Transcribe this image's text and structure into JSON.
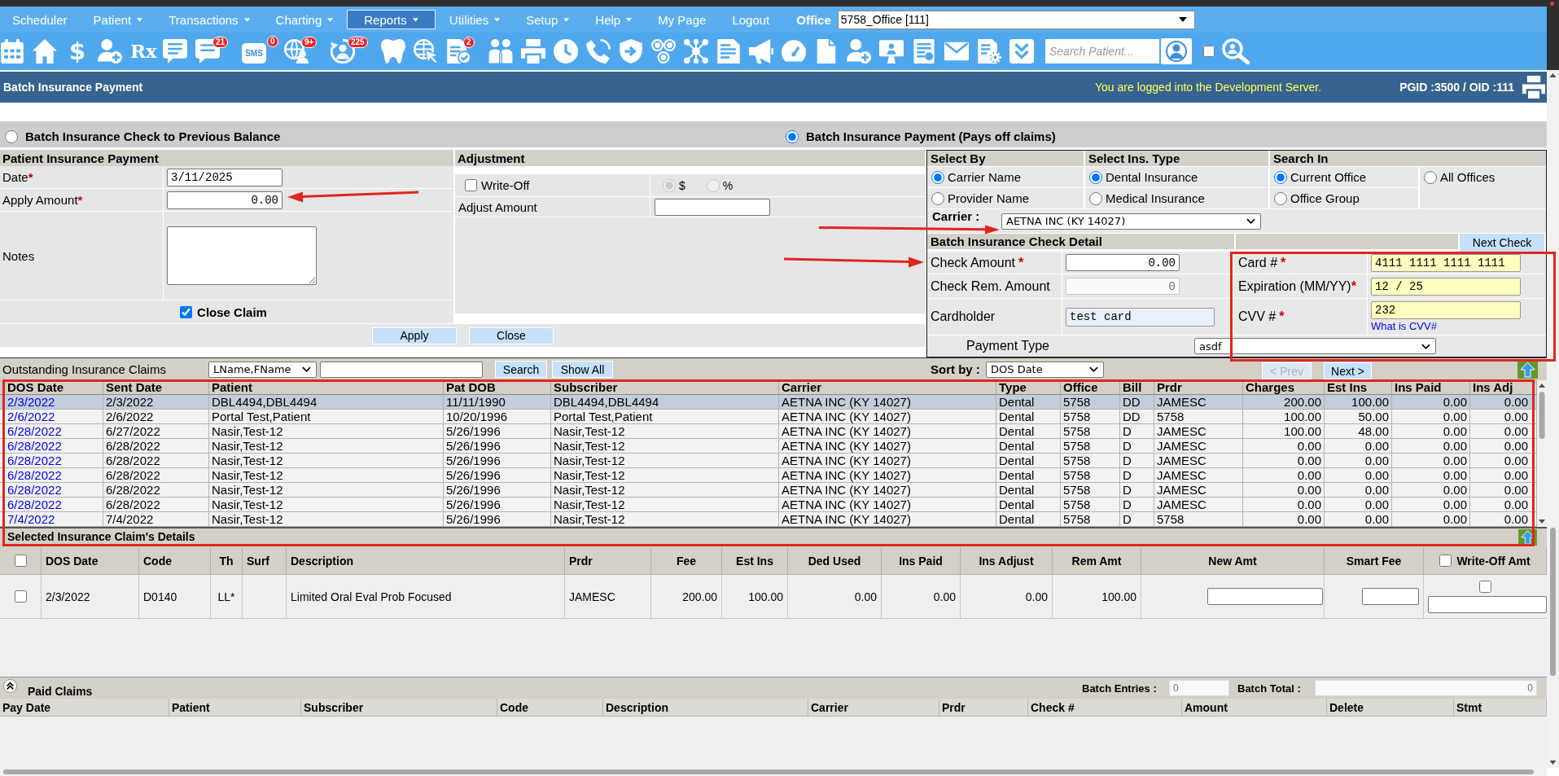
{
  "menu": {
    "items": [
      {
        "label": "Scheduler",
        "dropdown": false,
        "selected": false
      },
      {
        "label": "Patient",
        "dropdown": true,
        "selected": false
      },
      {
        "label": "Transactions",
        "dropdown": true,
        "selected": false
      },
      {
        "label": "Charting",
        "dropdown": true,
        "selected": false
      },
      {
        "label": "Reports",
        "dropdown": true,
        "selected": true
      },
      {
        "label": "Utilities",
        "dropdown": true,
        "selected": false
      },
      {
        "label": "Setup",
        "dropdown": true,
        "selected": false
      },
      {
        "label": "Help",
        "dropdown": true,
        "selected": false
      },
      {
        "label": "My Page",
        "dropdown": false,
        "selected": false
      },
      {
        "label": "Logout",
        "dropdown": false,
        "selected": false
      }
    ],
    "office_label": "Office",
    "office_value": "5758_Office [111]"
  },
  "toolbar": {
    "dollar_label": "$",
    "rx_label": "Rx",
    "sms_label": "SMS",
    "badges": [
      "21",
      "0",
      "9+",
      "225",
      "2"
    ],
    "search": {
      "placeholder": "Search Patient..."
    },
    "filter_checked": false
  },
  "title_bar": {
    "title": "Batch Insurance Payment",
    "notice": "You are logged into the Development Server.",
    "ids": "PGID :3500 / OID :111"
  },
  "mode_options": [
    {
      "label": "Batch Insurance Check to Previous Balance",
      "selected": false
    },
    {
      "label": "Batch Insurance Payment (Pays off claims)",
      "selected": true
    }
  ],
  "patient_payment": {
    "title": "Patient Insurance Payment",
    "date": {
      "label": "Date",
      "required_mark": "*",
      "value": "3/11/2025"
    },
    "apply_amount": {
      "label": "Apply Amount",
      "required_mark": "*",
      "value": "0.00"
    },
    "notes": {
      "label": "Notes"
    },
    "close_claim": {
      "label": "Close Claim",
      "checked": true
    },
    "buttons": [
      "Apply",
      "Close"
    ]
  },
  "adjustment": {
    "title": "Adjustment",
    "write_off": {
      "label": "Write-Off",
      "checked": false
    },
    "units": [
      {
        "label": "$",
        "selected": true,
        "disabled": true
      },
      {
        "label": "%",
        "selected": false,
        "disabled": true
      }
    ],
    "adjust_amount": {
      "label": "Adjust Amount"
    }
  },
  "select_by": {
    "groups": [
      {
        "title": "Select By",
        "options": [
          {
            "label": "Carrier Name",
            "selected": true
          },
          {
            "label": "Provider Name",
            "selected": false
          }
        ]
      },
      {
        "title": "Select Ins. Type",
        "options": [
          {
            "label": "Dental Insurance",
            "selected": true
          },
          {
            "label": "Medical Insurance",
            "selected": false
          }
        ]
      },
      {
        "title": "Search In",
        "options": [
          {
            "label": "Current Office",
            "selected": true
          },
          {
            "label": "All Offices",
            "selected": false
          },
          {
            "label": "Office Group",
            "selected": false
          }
        ]
      }
    ],
    "carrier": {
      "label": "Carrier :",
      "value": "AETNA INC (KY 14027)"
    }
  },
  "check_detail": {
    "title": "Batch Insurance Check Detail",
    "next_check": "Next Check",
    "fields": [
      {
        "label": "Check Amount",
        "required_mark": "*",
        "value": "0.00",
        "kind": "amount"
      },
      {
        "label": "Check Rem. Amount",
        "value": "0",
        "kind": "readonly"
      },
      {
        "label": "Cardholder",
        "value": "test card",
        "kind": "autofill"
      }
    ],
    "card_fields": [
      {
        "label": "Card #",
        "required_mark": "*",
        "value": "4111 1111 1111 1111"
      },
      {
        "label": "Expiration (MM/YY)",
        "required_mark": "*",
        "value": "12 / 25"
      },
      {
        "label": "CVV #",
        "required_mark": "*",
        "value": "232",
        "help_link": "What is CVV#"
      }
    ],
    "payment_type": {
      "label": "Payment Type",
      "value": "asdf"
    }
  },
  "outstanding": {
    "title": "Outstanding Insurance Claims",
    "name_format": "LName,FName",
    "search_button": "Search",
    "show_all_button": "Show All",
    "sort_label": "Sort by :",
    "sort_value": "DOS Date",
    "prev": {
      "label": "< Prev",
      "disabled": true
    },
    "next": {
      "label": "Next >",
      "disabled": false
    },
    "columns": [
      "DOS Date",
      "Sent Date",
      "Patient",
      "Pat DOB",
      "Subscriber",
      "Carrier",
      "Type",
      "Office",
      "Bill",
      "Prdr",
      "Charges",
      "Est Ins",
      "Ins Paid",
      "Ins Adj"
    ],
    "rows": [
      {
        "selected": true,
        "cells": [
          "2/3/2022",
          "2/3/2022",
          "DBL4494,DBL4494",
          "11/11/1990",
          "DBL4494,DBL4494",
          "AETNA INC (KY 14027)",
          "Dental",
          "5758",
          "DD",
          "JAMESC",
          "200.00",
          "100.00",
          "0.00",
          "0.00"
        ]
      },
      {
        "selected": false,
        "cells": [
          "2/6/2022",
          "2/6/2022",
          "Portal Test,Patient",
          "10/20/1996",
          "Portal Test,Patient",
          "AETNA INC (KY 14027)",
          "Dental",
          "5758",
          "DD",
          "5758",
          "100.00",
          "50.00",
          "0.00",
          "0.00"
        ]
      },
      {
        "selected": false,
        "cells": [
          "6/28/2022",
          "6/27/2022",
          "Nasir,Test-12",
          "5/26/1996",
          "Nasir,Test-12",
          "AETNA INC (KY 14027)",
          "Dental",
          "5758",
          "D",
          "JAMESC",
          "100.00",
          "48.00",
          "0.00",
          "0.00"
        ]
      },
      {
        "selected": false,
        "cells": [
          "6/28/2022",
          "6/28/2022",
          "Nasir,Test-12",
          "5/26/1996",
          "Nasir,Test-12",
          "AETNA INC (KY 14027)",
          "Dental",
          "5758",
          "D",
          "JAMESC",
          "0.00",
          "0.00",
          "0.00",
          "0.00"
        ]
      },
      {
        "selected": false,
        "cells": [
          "6/28/2022",
          "6/28/2022",
          "Nasir,Test-12",
          "5/26/1996",
          "Nasir,Test-12",
          "AETNA INC (KY 14027)",
          "Dental",
          "5758",
          "D",
          "JAMESC",
          "0.00",
          "0.00",
          "0.00",
          "0.00"
        ]
      },
      {
        "selected": false,
        "cells": [
          "6/28/2022",
          "6/28/2022",
          "Nasir,Test-12",
          "5/26/1996",
          "Nasir,Test-12",
          "AETNA INC (KY 14027)",
          "Dental",
          "5758",
          "D",
          "JAMESC",
          "0.00",
          "0.00",
          "0.00",
          "0.00"
        ]
      },
      {
        "selected": false,
        "cells": [
          "6/28/2022",
          "6/28/2022",
          "Nasir,Test-12",
          "5/26/1996",
          "Nasir,Test-12",
          "AETNA INC (KY 14027)",
          "Dental",
          "5758",
          "D",
          "JAMESC",
          "0.00",
          "0.00",
          "0.00",
          "0.00"
        ]
      },
      {
        "selected": false,
        "cells": [
          "6/28/2022",
          "6/28/2022",
          "Nasir,Test-12",
          "5/26/1996",
          "Nasir,Test-12",
          "AETNA INC (KY 14027)",
          "Dental",
          "5758",
          "D",
          "JAMESC",
          "0.00",
          "0.00",
          "0.00",
          "0.00"
        ]
      },
      {
        "selected": false,
        "cells": [
          "7/4/2022",
          "7/4/2022",
          "Nasir,Test-12",
          "5/26/1996",
          "Nasir,Test-12",
          "AETNA INC (KY 14027)",
          "Dental",
          "5758",
          "D",
          "5758",
          "0.00",
          "0.00",
          "0.00",
          "0.00"
        ]
      }
    ]
  },
  "details": {
    "title": "Selected Insurance Claim's Details",
    "select_all_checked": false,
    "write_off_all_checked": false,
    "columns": [
      "DOS Date",
      "Code",
      "Th",
      "Surf",
      "Description",
      "Prdr",
      "Fee",
      "Est Ins",
      "Ded Used",
      "Ins Paid",
      "Ins Adjust",
      "Rem Amt",
      "New Amt",
      "Smart Fee",
      "Write-Off Amt"
    ],
    "rows": [
      {
        "checked": false,
        "dos_date": "2/3/2022",
        "code": "D0140",
        "th": "LL*",
        "description": "Limited Oral Eval Prob Focused",
        "prdr": "JAMESC",
        "fee": "200.00",
        "est_ins": "100.00",
        "ded_used": "0.00",
        "ins_paid": "0.00",
        "ins_adjust": "0.00",
        "rem_amt": "100.00",
        "write_off_checked": false
      }
    ]
  },
  "paid_claims": {
    "title": "Paid Claims",
    "batch_entries_label": "Batch Entries :",
    "batch_entries": "0",
    "batch_total_label": "Batch Total :",
    "batch_total": "0",
    "columns": [
      "Pay Date",
      "Patient",
      "Subscriber",
      "Code",
      "Description",
      "Carrier",
      "Prdr",
      "Check #",
      "Amount",
      "Delete",
      "Stmt"
    ]
  }
}
